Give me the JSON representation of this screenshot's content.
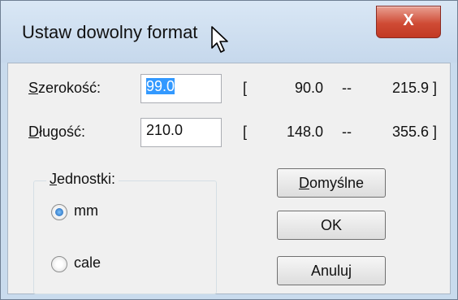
{
  "window": {
    "title": "Ustaw dowolny format",
    "close_label": "X"
  },
  "width_row": {
    "label_first": "S",
    "label_rest": "zerokość:",
    "value": "99.0",
    "bracket_open": "[",
    "min": "90.0",
    "dash": "--",
    "max": "215.9 ]"
  },
  "length_row": {
    "label_first": "D",
    "label_rest": "ługość:",
    "value": "210.0",
    "bracket_open": "[",
    "min": "148.0",
    "dash": "--",
    "max": "355.6 ]"
  },
  "units": {
    "title_first": "J",
    "title_rest": "ednostki:",
    "options": [
      {
        "label": "mm",
        "checked": true
      },
      {
        "label": "cale",
        "checked": false
      }
    ]
  },
  "buttons": {
    "defaults_first": "D",
    "defaults_rest": "omyślne",
    "ok": "OK",
    "cancel": "Anuluj"
  }
}
